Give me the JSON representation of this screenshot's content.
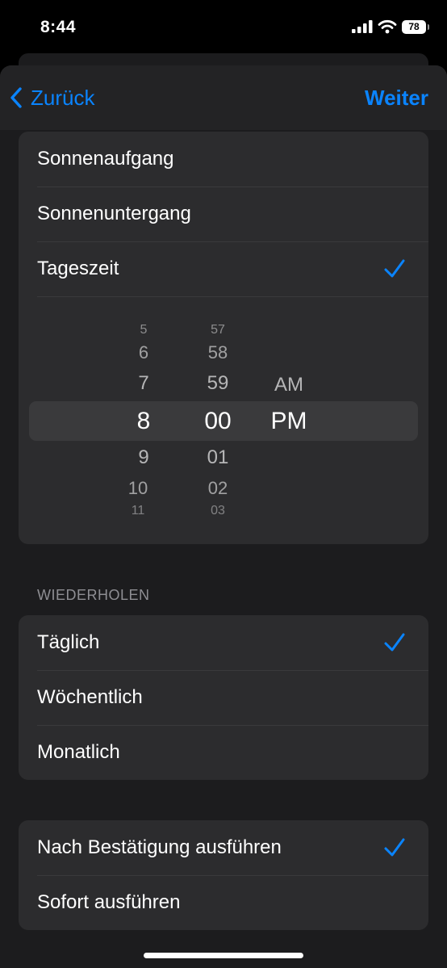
{
  "status_bar": {
    "time": "8:44",
    "battery": "78"
  },
  "nav": {
    "back_label": "Zurück",
    "next_label": "Weiter"
  },
  "trigger_options": [
    {
      "label": "Sonnenaufgang",
      "checked": false
    },
    {
      "label": "Sonnenuntergang",
      "checked": false
    },
    {
      "label": "Tageszeit",
      "checked": true
    }
  ],
  "time_picker": {
    "hours": [
      "5",
      "6",
      "7",
      "8",
      "9",
      "10",
      "11"
    ],
    "minutes": [
      "57",
      "58",
      "59",
      "00",
      "01",
      "02",
      "03"
    ],
    "periods": [
      "AM",
      "PM"
    ],
    "selected": {
      "hour": "8",
      "minute": "00",
      "period": "PM"
    }
  },
  "repeat": {
    "header": "WIEDERHOLEN",
    "options": [
      {
        "label": "Täglich",
        "checked": true
      },
      {
        "label": "Wöchentlich",
        "checked": false
      },
      {
        "label": "Monatlich",
        "checked": false
      }
    ]
  },
  "run_mode": {
    "options": [
      {
        "label": "Nach Bestätigung ausführen",
        "checked": true
      },
      {
        "label": "Sofort ausführen",
        "checked": false
      }
    ]
  },
  "colors": {
    "accent": "#0a84ff",
    "background": "#000000",
    "group": "#2c2c2e"
  }
}
